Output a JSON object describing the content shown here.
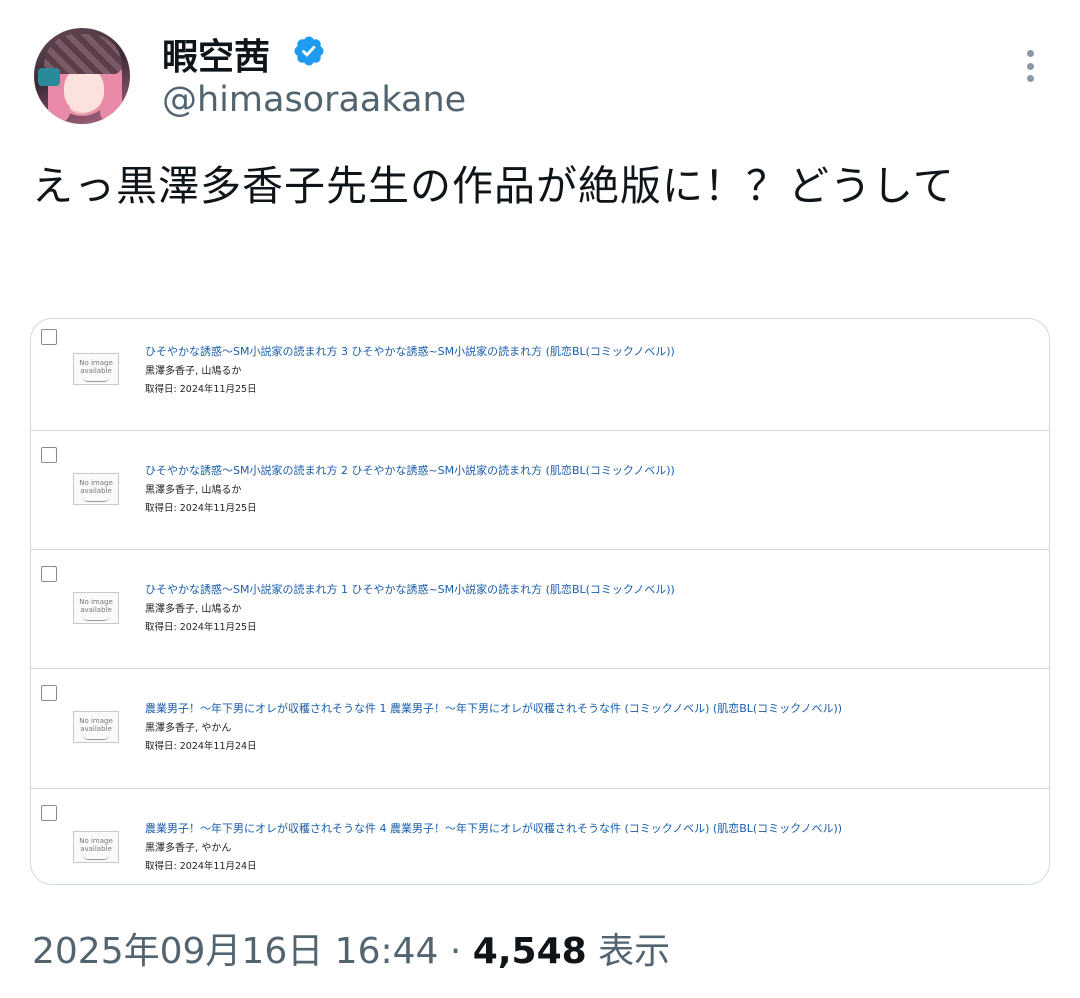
{
  "user": {
    "name": "暇空茜",
    "handle": "@himasoraakane",
    "verified_color": "#1d9bf0"
  },
  "tweet": {
    "text": "えっ黒澤多香子先生の作品が絶版に！？どうして"
  },
  "attached_image": {
    "no_image_line1": "No image",
    "no_image_line2": "available",
    "acquired_label": "取得日: ",
    "rows": [
      {
        "title": "ひそやかな誘惑～SM小説家の読まれ方 3 ひそやかな誘惑~SM小説家の読まれ方 (肌恋BL(コミックノベル))",
        "authors": "黒澤多香子, 山鳩るか",
        "acquired_date": "2024年11月25日"
      },
      {
        "title": "ひそやかな誘惑～SM小説家の読まれ方 2 ひそやかな誘惑~SM小説家の読まれ方 (肌恋BL(コミックノベル))",
        "authors": "黒澤多香子, 山鳩るか",
        "acquired_date": "2024年11月25日"
      },
      {
        "title": "ひそやかな誘惑～SM小説家の読まれ方 1 ひそやかな誘惑~SM小説家の読まれ方 (肌恋BL(コミックノベル))",
        "authors": "黒澤多香子, 山鳩るか",
        "acquired_date": "2024年11月25日"
      },
      {
        "title": "農業男子！～年下男にオレが収穫されそうな件 1 農業男子！～年下男にオレが収穫されそうな件 (コミックノベル) (肌恋BL(コミックノベル))",
        "authors": "黒澤多香子, やかん",
        "acquired_date": "2024年11月24日"
      },
      {
        "title": "農業男子！～年下男にオレが収穫されそうな件 4 農業男子！～年下男にオレが収穫されそうな件 (コミックノベル) (肌恋BL(コミックノベル))",
        "authors": "黒澤多香子, やかん",
        "acquired_date": "2024年11月24日"
      }
    ]
  },
  "footer": {
    "timestamp": "2025年09月16日 16:44",
    "separator": "·",
    "views_count": "4,548",
    "views_label": "表示"
  }
}
